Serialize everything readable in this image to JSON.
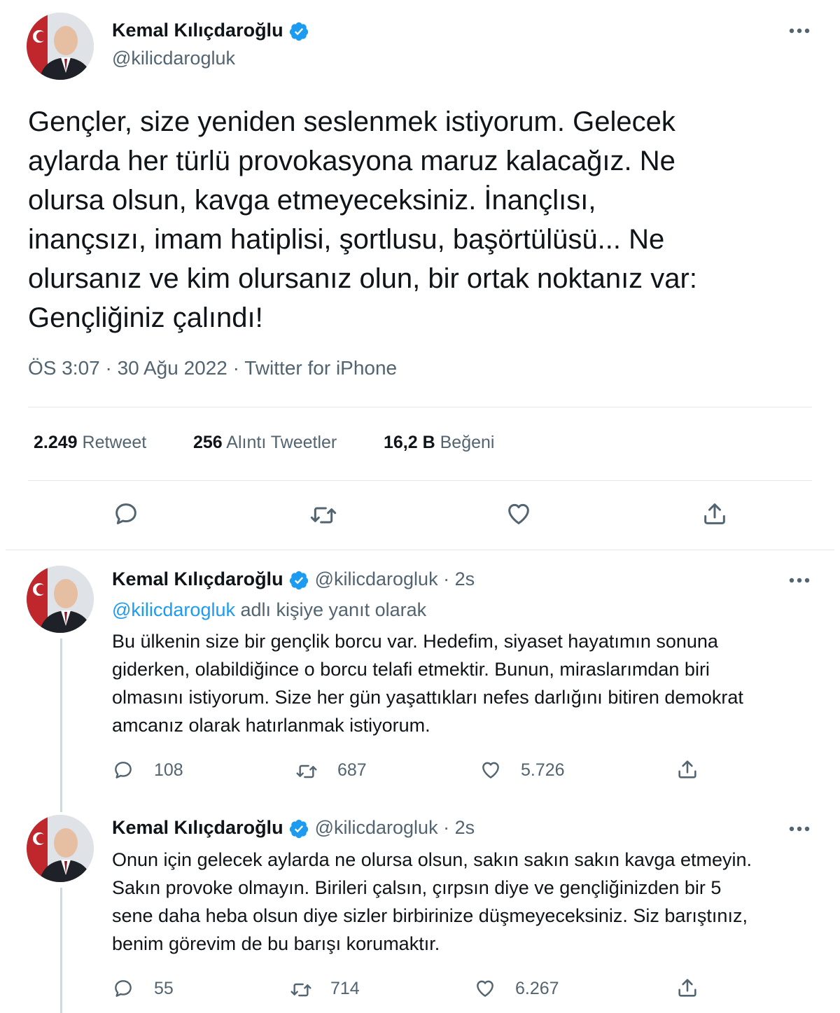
{
  "main_tweet": {
    "author_name": "Kemal Kılıçdaroğlu",
    "author_handle": "@kilicdarogluk",
    "text": "Gençler, size yeniden seslenmek istiyorum. Gelecek\naylarda her türlü provokasyona maruz kalacağız. Ne\nolursa olsun, kavga etmeyeceksiniz. İnançlısı,\ninançsızı, imam hatiplisi, şortlusu, başörtülüsü... Ne\nolursanız ve kim olursanız olun, bir ortak noktanız var:\nGençliğiniz çalındı!",
    "meta": "ÖS 3:07 · 30 Ağu 2022 · Twitter for iPhone",
    "stats": {
      "retweets_count": "2.249",
      "retweets_label": "Retweet",
      "quotes_count": "256",
      "quotes_label": "Alıntı Tweetler",
      "likes_count": "16,2 B",
      "likes_label": "Beğeni"
    },
    "actions": [
      "reply-icon",
      "retweet-icon",
      "like-icon",
      "share-icon"
    ]
  },
  "replies": [
    {
      "author_name": "Kemal Kılıçdaroğlu",
      "author_handle": "@kilicdarogluk · 2s",
      "reply_to_link": "@kilicdarogluk",
      "reply_to_text": " adlı kişiye yanıt olarak",
      "text": "Bu ülkenin size bir gençlik borcu var. Hedefim, siyaset hayatımın sonuna\ngiderken, olabildiğince o borcu telafi etmektir. Bunun, miraslarımdan biri\nolmasını istiyorum. Size her gün yaşattıkları nefes darlığını bitiren demokrat\namcanız olarak hatırlanmak istiyorum.",
      "reply_count": "108",
      "retweet_count": "687",
      "like_count": "5.726"
    },
    {
      "author_name": "Kemal Kılıçdaroğlu",
      "author_handle": "@kilicdarogluk · 2s",
      "text": "Onun için gelecek aylarda ne olursa olsun, sakın sakın sakın kavga etmeyin.\nSakın provoke olmayın. Birileri çalsın, çırpsın diye ve gençliğinizden bir 5\nsene daha heba olsun diye sizler birbirinize düşmeyeceksiniz. Siz barıştınız,\nbenim görevim de bu barışı korumaktır.",
      "reply_count": "55",
      "retweet_count": "714",
      "like_count": "6.267"
    }
  ],
  "colors": {
    "verified": "#1d9bf0",
    "text": "#0f1419",
    "secondary": "#536471",
    "link": "#1d9bf0"
  }
}
